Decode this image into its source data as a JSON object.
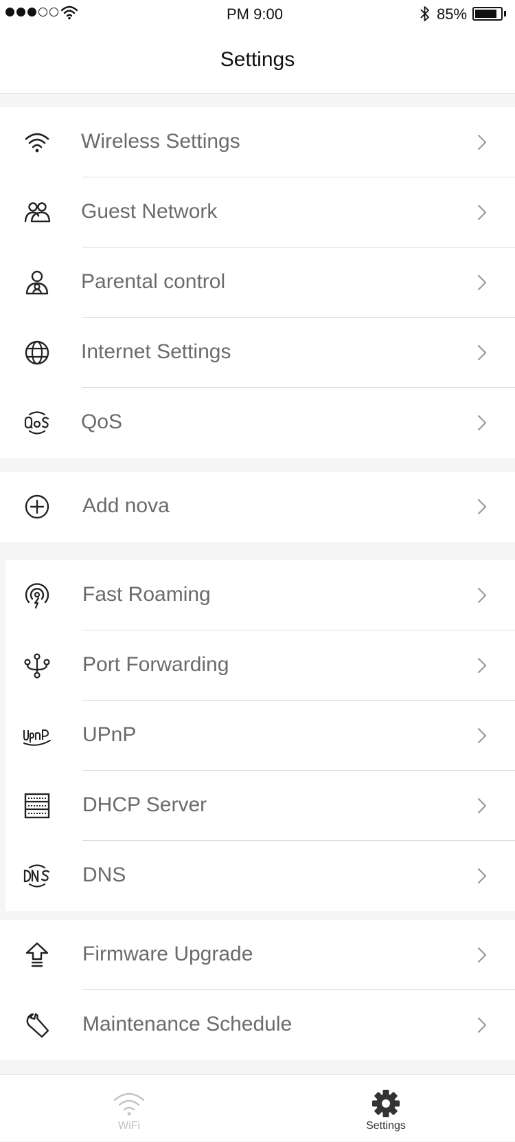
{
  "status_bar": {
    "time": "PM  9:00",
    "battery_percent": "85%",
    "battery_level": 0.85,
    "signal_bars_filled": 3,
    "signal_bars_total": 5
  },
  "nav": {
    "title": "Settings"
  },
  "groups": [
    {
      "items": [
        {
          "label": "Wireless Settings",
          "icon": "wifi-icon"
        },
        {
          "label": "Guest Network",
          "icon": "guests-icon"
        },
        {
          "label": "Parental control",
          "icon": "parental-icon"
        },
        {
          "label": "Internet Settings",
          "icon": "globe-icon"
        },
        {
          "label": "QoS",
          "icon": "qos-icon"
        }
      ]
    },
    {
      "items": [
        {
          "label": "Add nova",
          "icon": "add-circle-icon"
        }
      ]
    },
    {
      "items": [
        {
          "label": "Fast Roaming",
          "icon": "roaming-icon"
        },
        {
          "label": "Port Forwarding",
          "icon": "port-forwarding-icon"
        },
        {
          "label": "UPnP",
          "icon": "upnp-icon"
        },
        {
          "label": "DHCP Server",
          "icon": "dhcp-server-icon"
        },
        {
          "label": "DNS",
          "icon": "dns-icon"
        }
      ]
    },
    {
      "items": [
        {
          "label": "Firmware Upgrade",
          "icon": "upgrade-icon"
        },
        {
          "label": "Maintenance Schedule",
          "icon": "wrench-icon"
        }
      ]
    }
  ],
  "tab_bar": {
    "tabs": [
      {
        "label": "WiFi",
        "icon": "wifi-icon",
        "active": false
      },
      {
        "label": "Settings",
        "icon": "gear-icon",
        "active": true
      }
    ]
  },
  "colors": {
    "label": "#6b6b6b",
    "icon": "#222222",
    "divider": "#dcdcdc",
    "background": "#f5f5f5",
    "tab_inactive": "#c2c2c2",
    "tab_active": "#333333"
  }
}
